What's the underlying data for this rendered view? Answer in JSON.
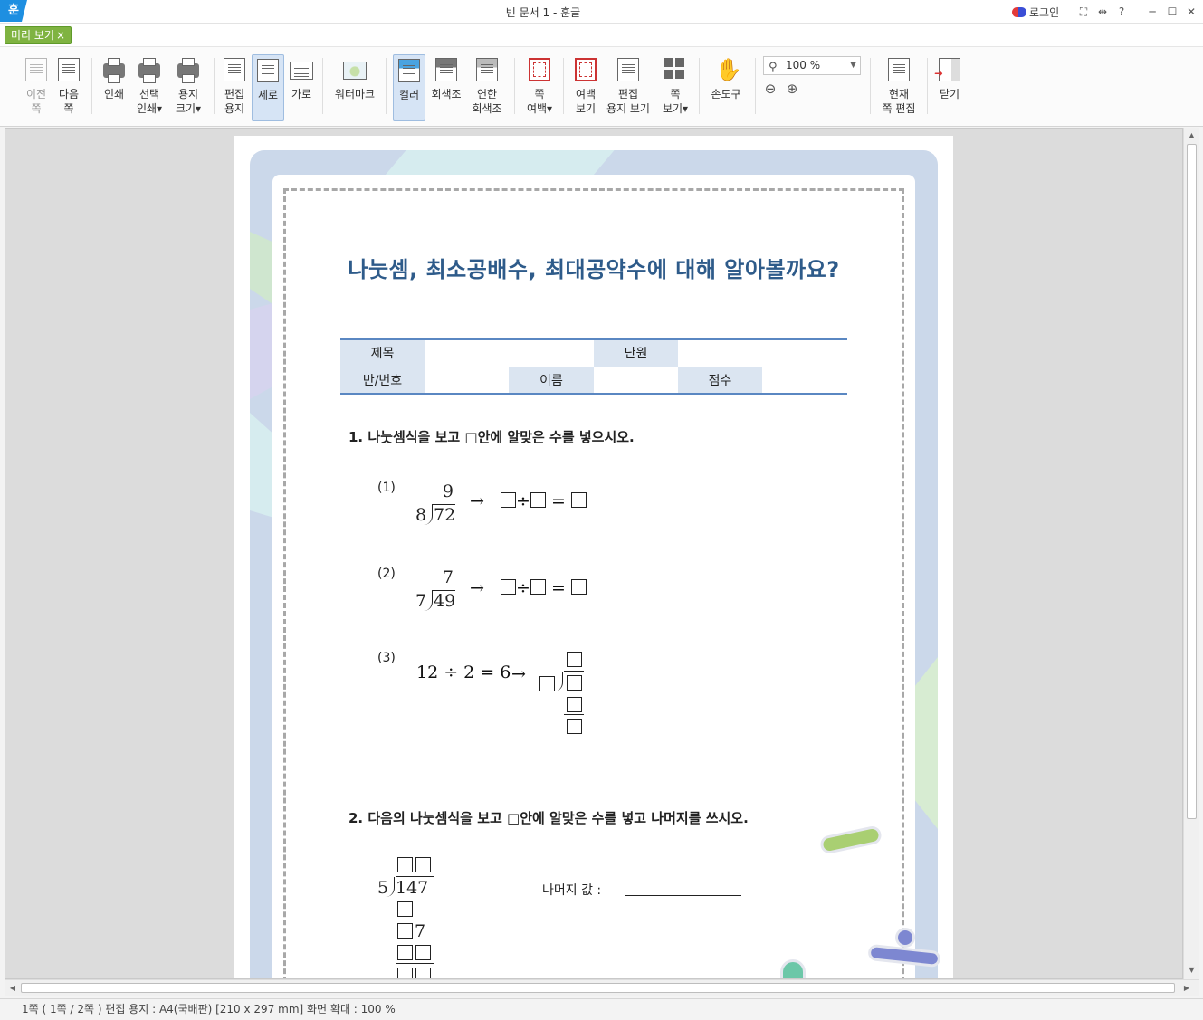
{
  "app": {
    "logo": "훈",
    "window_title": "빈 문서 1 - 훈글",
    "login": "로그인",
    "titlebar_icons": [
      "fullscreen-icon",
      "split-icon",
      "help-icon",
      "minimize-icon",
      "maximize-icon",
      "close-icon"
    ],
    "titlebar_glyphs": [
      "⛶",
      "⇹",
      "?",
      "─",
      "☐",
      "✕"
    ]
  },
  "tab": {
    "label": "미리 보기",
    "close": "×"
  },
  "ribbon": {
    "prev_page": [
      "이전",
      "쪽"
    ],
    "next_page": [
      "다음",
      "쪽"
    ],
    "print": "인쇄",
    "select_print": [
      "선택",
      "인쇄▾"
    ],
    "paper_size": [
      "용지",
      "크기▾"
    ],
    "edit_paper": [
      "편집",
      "용지"
    ],
    "portrait": "세로",
    "landscape": "가로",
    "watermark": "워터마크",
    "color": "컬러",
    "grayscale": "회색조",
    "light_grayscale": [
      "연한",
      "회색조"
    ],
    "page_margin": [
      "쪽",
      "여백▾"
    ],
    "margin_view": [
      "여백",
      "보기"
    ],
    "paper_view": [
      "편집",
      "용지 보기"
    ],
    "page_view": [
      "쪽",
      "보기▾"
    ],
    "hand_tool": "손도구",
    "zoom_value": "100 %",
    "current_page_edit": [
      "현재",
      "쪽 편집"
    ],
    "close": "닫기"
  },
  "document": {
    "title": "나눗셈, 최소공배수, 최대공약수에 대해 알아볼까요?",
    "info_table": {
      "subject": "제목",
      "unit": "단원",
      "class_no": "반/번호",
      "name": "이름",
      "score": "점수"
    },
    "q1": "1. 나눗셈식을 보고 □안에 알맞은 수를 넣으시오.",
    "q1_items": [
      {
        "num": "(1)",
        "divisor": "8",
        "dividend": "72",
        "quotient": "9"
      },
      {
        "num": "(2)",
        "divisor": "7",
        "dividend": "49",
        "quotient": "7"
      },
      {
        "num": "(3)",
        "expr": "12 ÷ 2 = 6"
      }
    ],
    "arrow": "→",
    "div_sign": "÷",
    "eq_sign": "=",
    "q2": "2. 다음의 나눗셈식을 보고 □안에 알맞은 수를 넣고 나머지를 쓰시오.",
    "q2_divisor": "5",
    "q2_dividend": "147",
    "q2_partial": "7",
    "remainder_label": "나머지 값 :"
  },
  "status": "1쪽 ( 1쪽 / 2쪽 ) 편집 용지 : A4(국배판)  [210 x 297 mm]  화면 확대 : 100 %",
  "colors": {
    "accent": "#2e5b8a",
    "tab_green": "#7fb341",
    "frame": "#cbd8ea",
    "table_line": "#5a87c2"
  }
}
